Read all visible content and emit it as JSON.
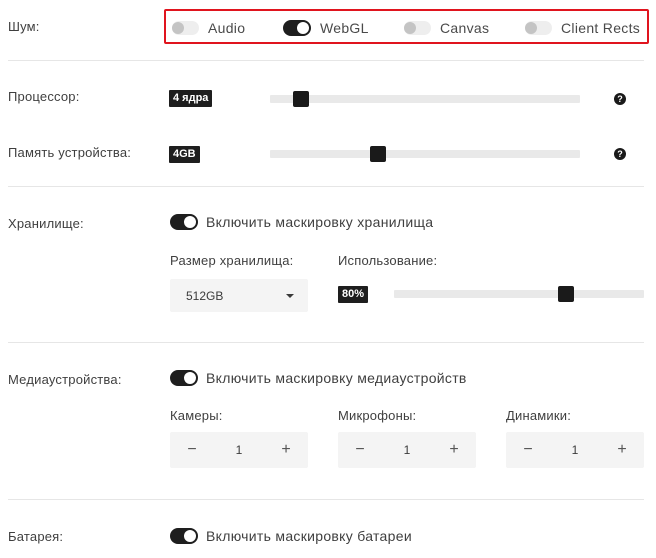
{
  "noise": {
    "label": "Шум:",
    "items": [
      {
        "label": "Audio",
        "on": false
      },
      {
        "label": "WebGL",
        "on": true
      },
      {
        "label": "Canvas",
        "on": false
      },
      {
        "label": "Client Rects",
        "on": false
      }
    ],
    "highlight_color": "#e0141e"
  },
  "processor": {
    "label": "Процессор:",
    "badge": "4 ядра",
    "slider_fraction": 0.078,
    "help": "?"
  },
  "memory": {
    "label": "Память устройства:",
    "badge": "4GB",
    "slider_fraction": 0.34,
    "help": "?"
  },
  "storage": {
    "label": "Хранилище:",
    "toggle_label": "Включить маскировку хранилища",
    "toggle_on": true,
    "size_label": "Размер хранилища:",
    "size_value": "512GB",
    "usage_label": "Использование:",
    "usage_badge": "80%",
    "usage_fraction": 0.7
  },
  "media": {
    "label": "Медиаустройства:",
    "toggle_label": "Включить маскировку медиаустройств",
    "toggle_on": true,
    "cameras": {
      "label": "Камеры:",
      "value": "1"
    },
    "microphones": {
      "label": "Микрофоны:",
      "value": "1"
    },
    "speakers": {
      "label": "Динамики:",
      "value": "1"
    },
    "minus": "−",
    "plus": "+"
  },
  "battery": {
    "label": "Батарея:",
    "toggle_label": "Включить маскировку батареи",
    "toggle_on": true
  },
  "colors": {
    "accent_dark": "#1e1e1e",
    "track": "#e9e9e9",
    "field_bg": "#f4f4f4"
  }
}
